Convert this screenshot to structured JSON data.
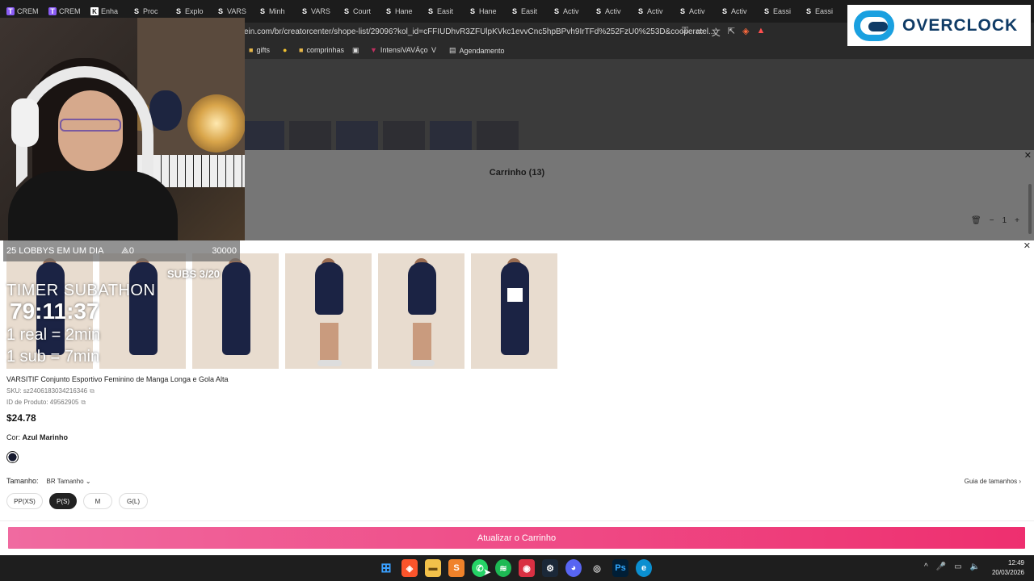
{
  "browser": {
    "tabs": [
      {
        "label": "CREM",
        "fav": "T",
        "kind": "tw"
      },
      {
        "label": "CREM",
        "fav": "T",
        "kind": "tw"
      },
      {
        "label": "Enha",
        "fav": "K",
        "kind": "kk"
      },
      {
        "label": "Proc",
        "fav": "S",
        "kind": "s"
      },
      {
        "label": "Explo",
        "fav": "S",
        "kind": "s"
      },
      {
        "label": "VARS",
        "fav": "S",
        "kind": "s"
      },
      {
        "label": "Minh",
        "fav": "S",
        "kind": "s"
      },
      {
        "label": "VARS",
        "fav": "S",
        "kind": "s"
      },
      {
        "label": "Court",
        "fav": "S",
        "kind": "s"
      },
      {
        "label": "Hane",
        "fav": "S",
        "kind": "s"
      },
      {
        "label": "Easit",
        "fav": "S",
        "kind": "s"
      },
      {
        "label": "Hane",
        "fav": "S",
        "kind": "s"
      },
      {
        "label": "Easit",
        "fav": "S",
        "kind": "s"
      },
      {
        "label": "Activ",
        "fav": "S",
        "kind": "s"
      },
      {
        "label": "Activ",
        "fav": "S",
        "kind": "s"
      },
      {
        "label": "Activ",
        "fav": "S",
        "kind": "s"
      },
      {
        "label": "Activ",
        "fav": "S",
        "kind": "s"
      },
      {
        "label": "Activ",
        "fav": "S",
        "kind": "s"
      },
      {
        "label": "Eassi",
        "fav": "S",
        "kind": "s"
      },
      {
        "label": "Eassi",
        "fav": "S",
        "kind": "s"
      }
    ],
    "url": "ein.com/br/creatorcenter/shope-list/29096?kol_id=cFFIUDhvR3ZFUlpKVkc1evvCnc5hpBPvh9IrTFd%252FzU0%253D&cooperatel...",
    "bookmarks": {
      "gifts": "gifts",
      "comprinhas": "comprinhas",
      "intensi": "IntensiVAVÁço",
      "agendamento": "Agendamento"
    }
  },
  "cart": {
    "title": "Carrinho (13)",
    "qty": "1"
  },
  "overlay": {
    "goal_label": "25 LOBBYS EM UM DIA",
    "goal_current": "0",
    "goal_target": "30000",
    "subs": "SUBS 3/20",
    "timer_title": "TIMER SUBATHON",
    "timer_value": "79:11:37",
    "rate_real": "1 real = 2min",
    "rate_sub": "1 sub = 7min"
  },
  "logo": {
    "text": "OVERCLOCK"
  },
  "product": {
    "name": "VARSITIF Conjunto Esportivo Feminino de Manga Longa e Gola Alta",
    "sku": "SKU: sz2406183034216346",
    "product_id": "ID de Produto: 49562905",
    "price": "$24.78",
    "color_label": "Cor:",
    "color_value": "Azul Marinho",
    "size_label": "Tamanho:",
    "size_unit": "BR Tamanho",
    "size_guide": "Guia de tamanhos",
    "sizes": [
      "PP(XS)",
      "P(S)",
      "M",
      "G(L)"
    ],
    "selected_size": "P(S)",
    "update_button": "Atualizar o Carrinho"
  },
  "taskbar": {
    "time": "12:49",
    "date": "20/03/2026"
  },
  "colors": {
    "accent_pink_start": "#f06aa0",
    "accent_pink_end": "#ee2f6f",
    "navy": "#1b2344",
    "logo_blue": "#1aa0e0"
  }
}
